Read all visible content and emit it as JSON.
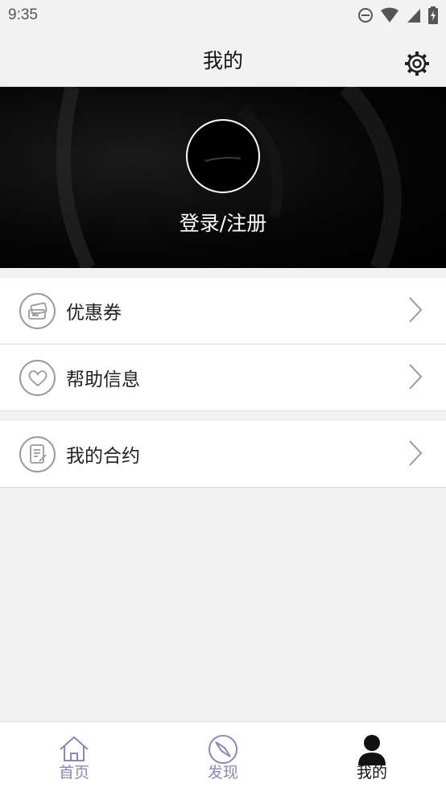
{
  "status_bar": {
    "time": "9:35"
  },
  "header": {
    "title": "我的"
  },
  "profile": {
    "login_label": "登录/注册"
  },
  "menu": {
    "group1": [
      {
        "label": "优惠券",
        "icon": "ticket-icon"
      },
      {
        "label": "帮助信息",
        "icon": "heart-icon"
      }
    ],
    "group2": [
      {
        "label": "我的合约",
        "icon": "contract-icon"
      }
    ]
  },
  "bottom_nav": {
    "items": [
      {
        "label": "首页",
        "icon": "home-icon",
        "active": false
      },
      {
        "label": "发现",
        "icon": "compass-icon",
        "active": false
      },
      {
        "label": "我的",
        "icon": "person-icon",
        "active": true
      }
    ]
  },
  "colors": {
    "nav_inactive": "#8e86b8",
    "nav_active": "#111111",
    "banner_bg": "#000000"
  }
}
